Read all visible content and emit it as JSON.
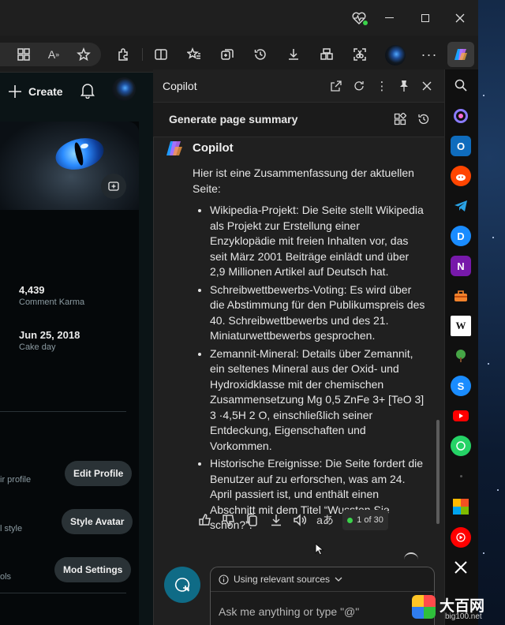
{
  "window": {
    "title_icons": [
      "heart-pulse-icon",
      "minimize-icon",
      "maximize-icon",
      "close-icon"
    ],
    "toolbar_icons": [
      "apps-icon",
      "read-aloud-icon",
      "favorite-star-icon",
      "extensions-icon",
      "split-screen-icon",
      "favorites-icon",
      "collections-icon",
      "history-icon",
      "downloads-icon",
      "workspaces-icon",
      "screenshot-icon",
      "profile-avatar",
      "more-icon",
      "copilot-icon"
    ]
  },
  "reddit": {
    "create_label": "Create",
    "stats": [
      {
        "value": "4,439",
        "label": "Comment Karma"
      },
      {
        "value": "Jun 25, 2018",
        "label": "Cake day"
      }
    ],
    "settings": [
      {
        "label": "ir profile",
        "button": "Edit Profile"
      },
      {
        "label": "l style",
        "button": "Style Avatar"
      },
      {
        "label": "ols",
        "button": "Mod Settings"
      }
    ]
  },
  "copilot": {
    "title": "Copilot",
    "summary_label": "Generate page summary",
    "sender": "Copilot",
    "intro": "Hier ist eine Zusammenfassung der aktuellen Seite:",
    "bullets": [
      "Wikipedia-Projekt: Die Seite stellt Wikipedia als Projekt zur Erstellung einer Enzyklopädie mit freien Inhalten vor, das seit März 2001 Beiträge einlädt und über 2,9 Millionen Artikel auf Deutsch hat.",
      "Schreibwettbewerbs-Voting: Es wird über die Abstimmung für den Publikumspreis des 40. Schreibwettbewerbs und des 21. Miniaturwettbewerbs gesprochen.",
      "Zemannit-Mineral: Details über Zemannit, ein seltenes Mineral aus der Oxid- und Hydroxidklasse mit der chemischen Zusammensetzung Mg 0,5 ZnFe 3+ [TeO 3] 3 ·4,5H 2 O, einschließlich seiner Entdeckung, Eigenschaften und Vorkommen.",
      "Historische Ereignisse: Die Seite fordert die Benutzer auf zu erforschen, was am 24. April passiert ist, und enthält einen Abschnitt mit dem Titel “Wussten Sie schon?”."
    ],
    "counter": "1 of 30",
    "sources_label": "Using relevant sources",
    "input_placeholder": "Ask me anything or type \"@\"",
    "accent": "#0f6b86"
  },
  "sidebar_icons": [
    "search-icon",
    "copilot-app-icon",
    "outlook-icon",
    "reddit-icon",
    "telegram-icon",
    "disney-icon",
    "onenote-icon",
    "tools-icon",
    "wikipedia-icon",
    "tree-icon",
    "skype-icon",
    "youtube-icon",
    "whatsapp-icon",
    "dot-icon",
    "office-icon",
    "youtube-music-icon",
    "x-icon"
  ],
  "watermark": {
    "title": "大百网",
    "url": "big100.net"
  }
}
